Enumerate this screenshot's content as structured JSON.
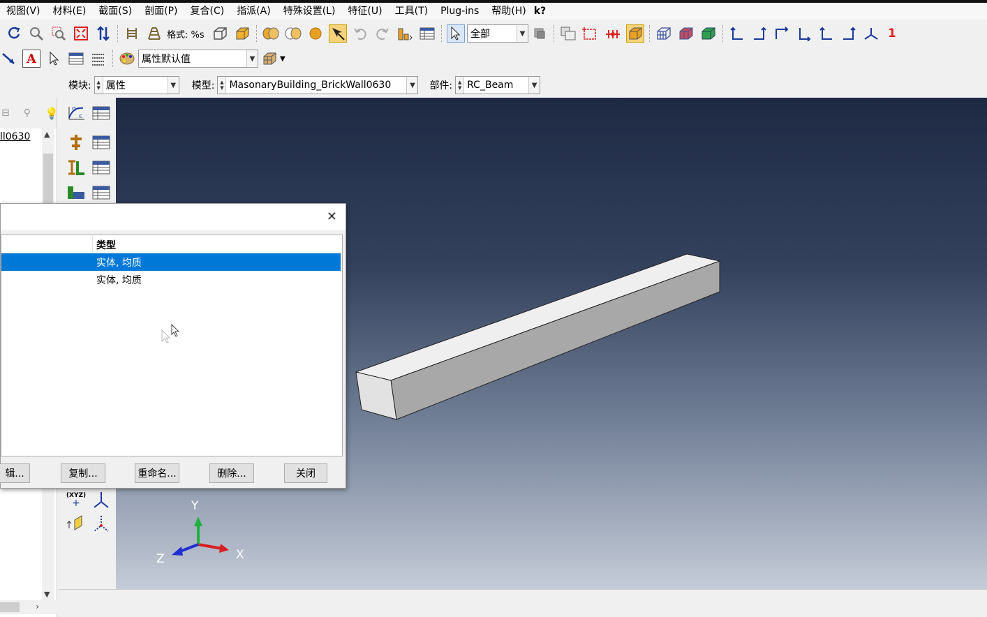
{
  "menubar": {
    "items": [
      "视图(V)",
      "材料(E)",
      "截面(S)",
      "剖面(P)",
      "复合(C)",
      "指派(A)",
      "特殊设置(L)",
      "特征(U)",
      "工具(T)",
      "Plug-ins",
      "帮助(H)"
    ],
    "context_help": "k?"
  },
  "toolbar": {
    "style_label": "格式: %s",
    "selection_filter": "全部",
    "attribute_default": "属性默认值",
    "view_number": "1"
  },
  "context": {
    "module_label": "模块:",
    "module_value": "属性",
    "model_label": "模型:",
    "model_value": "MasonaryBuilding_BrickWall0630",
    "part_label": "部件:",
    "part_value": "RC_Beam"
  },
  "tree": {
    "visible_text": "ll0630"
  },
  "dialog": {
    "column_type": "类型",
    "rows": [
      {
        "type": "实体, 均质",
        "selected": true
      },
      {
        "type": "实体, 均质",
        "selected": false
      }
    ],
    "buttons": {
      "edit": "辑...",
      "copy": "复制...",
      "rename": "重命名...",
      "delete": "删除...",
      "close": "关闭"
    }
  },
  "triad": {
    "x": "X",
    "y": "Y",
    "z": "Z"
  },
  "palette": {
    "csys_label": "(XYZ)"
  },
  "colors": {
    "selection": "#0078d7",
    "viewport_top": "#1e2a44",
    "viewport_bottom": "#c5ccd8",
    "axis_x": "#d62020",
    "axis_y": "#20b040",
    "axis_z": "#2030d0"
  }
}
